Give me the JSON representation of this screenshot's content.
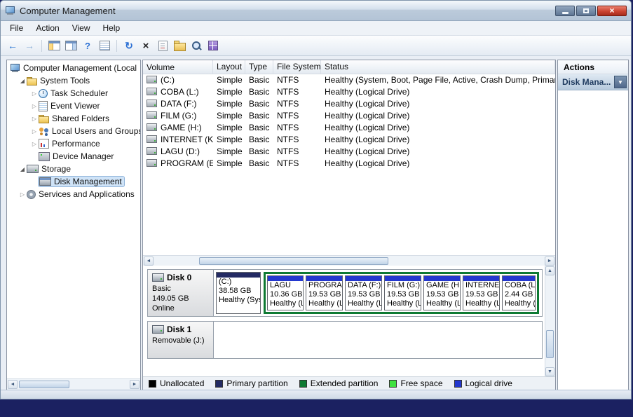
{
  "window": {
    "title": "Computer Management",
    "controls": {
      "close_glyph": "×"
    }
  },
  "menu": {
    "items": [
      "File",
      "Action",
      "View",
      "Help"
    ]
  },
  "toolbar": {
    "icons": [
      {
        "name": "back-icon",
        "glyph": "←"
      },
      {
        "name": "forward-icon",
        "glyph": "→"
      },
      {
        "name": "show-console-tree-icon",
        "glyph": ""
      },
      {
        "name": "show-action-pane-icon",
        "glyph": ""
      },
      {
        "name": "help-icon",
        "glyph": "?"
      },
      {
        "name": "export-list-icon",
        "glyph": ""
      },
      {
        "name": "refresh-icon",
        "glyph": "↻"
      },
      {
        "name": "delete-icon",
        "glyph": "×"
      },
      {
        "name": "properties-icon",
        "glyph": ""
      },
      {
        "name": "open-folder-icon",
        "glyph": ""
      },
      {
        "name": "search-icon",
        "glyph": ""
      },
      {
        "name": "grid-icon",
        "glyph": ""
      }
    ]
  },
  "scrollbar": {
    "left": "◄",
    "right": "►",
    "up": "▲",
    "down": "▼"
  },
  "tree": {
    "items": [
      {
        "label": "Computer Management (Local",
        "exp": ""
      },
      {
        "label": "System Tools",
        "exp": "◢"
      },
      {
        "label": "Task Scheduler",
        "exp": "▷"
      },
      {
        "label": "Event Viewer",
        "exp": "▷"
      },
      {
        "label": "Shared Folders",
        "exp": "▷"
      },
      {
        "label": "Local Users and Groups",
        "exp": "▷"
      },
      {
        "label": "Performance",
        "exp": "▷"
      },
      {
        "label": "Device Manager",
        "exp": ""
      },
      {
        "label": "Storage",
        "exp": "◢"
      },
      {
        "label": "Disk Management",
        "exp": ""
      },
      {
        "label": "Services and Applications",
        "exp": "▷"
      }
    ]
  },
  "volume_list": {
    "columns": [
      "Volume",
      "Layout",
      "Type",
      "File System",
      "Status"
    ],
    "rows": [
      {
        "volume": "(C:)",
        "layout": "Simple",
        "type": "Basic",
        "fs": "NTFS",
        "status": "Healthy (System, Boot, Page File, Active, Crash Dump, Primar"
      },
      {
        "volume": "COBA (L:)",
        "layout": "Simple",
        "type": "Basic",
        "fs": "NTFS",
        "status": "Healthy (Logical Drive)"
      },
      {
        "volume": "DATA (F:)",
        "layout": "Simple",
        "type": "Basic",
        "fs": "NTFS",
        "status": "Healthy (Logical Drive)"
      },
      {
        "volume": "FILM (G:)",
        "layout": "Simple",
        "type": "Basic",
        "fs": "NTFS",
        "status": "Healthy (Logical Drive)"
      },
      {
        "volume": "GAME (H:)",
        "layout": "Simple",
        "type": "Basic",
        "fs": "NTFS",
        "status": "Healthy (Logical Drive)"
      },
      {
        "volume": "INTERNET (K:)",
        "layout": "Simple",
        "type": "Basic",
        "fs": "NTFS",
        "status": "Healthy (Logical Drive)"
      },
      {
        "volume": "LAGU (D:)",
        "layout": "Simple",
        "type": "Basic",
        "fs": "NTFS",
        "status": "Healthy (Logical Drive)"
      },
      {
        "volume": "PROGRAM (E:)",
        "layout": "Simple",
        "type": "Basic",
        "fs": "NTFS",
        "status": "Healthy (Logical Drive)"
      }
    ]
  },
  "disks": [
    {
      "name": "Disk 0",
      "kind": "Basic",
      "size": "149.05 GB",
      "state": "Online",
      "partitions": [
        {
          "label": "(C:)",
          "size": "38.58 GB",
          "status": "Healthy (System, Boot, Page File, Active, Crash Dump, Primar",
          "type": "primary"
        },
        {
          "label": "LAGU",
          "size": "10.36 GB",
          "status": "Healthy (Logical Drive)",
          "type": "logical"
        },
        {
          "label": "PROGRAM (E:)",
          "size": "19.53 GB",
          "status": "Healthy (Logical Drive)",
          "type": "logical"
        },
        {
          "label": "DATA (F:)",
          "size": "19.53 GB",
          "status": "Healthy (Logical Drive)",
          "type": "logical"
        },
        {
          "label": "FILM (G:)",
          "size": "19.53 GB",
          "status": "Healthy (Logical Drive)",
          "type": "logical"
        },
        {
          "label": "GAME (H:)",
          "size": "19.53 GB",
          "status": "Healthy (Logical Drive)",
          "type": "logical"
        },
        {
          "label": "INTERNET (K:)",
          "size": "19.53 GB",
          "status": "Healthy (Logical Drive)",
          "type": "logical"
        },
        {
          "label": "COBA (L:)",
          "size": "2.44 GB",
          "status": "Healthy (Logical Drive)",
          "type": "logical"
        }
      ]
    },
    {
      "name": "Disk 1",
      "kind": "Removable (J:)"
    }
  ],
  "legend": {
    "items": [
      {
        "label": "Unallocated",
        "color": "#000000"
      },
      {
        "label": "Primary partition",
        "color": "#232a63"
      },
      {
        "label": "Extended partition",
        "color": "#0e7a33"
      },
      {
        "label": "Free space",
        "color": "#3fe23f"
      },
      {
        "label": "Logical drive",
        "color": "#2438cf"
      }
    ]
  },
  "actions": {
    "title": "Actions",
    "sections": [
      {
        "label": "Disk Mana...",
        "chevron": "▼"
      }
    ]
  }
}
